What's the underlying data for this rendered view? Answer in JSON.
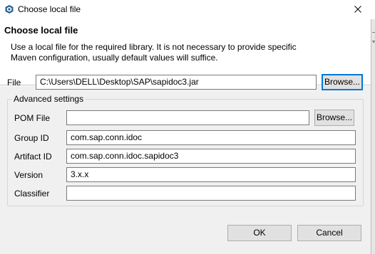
{
  "window": {
    "title": "Choose local file",
    "close_icon": "close-icon",
    "app_icon": "app-logo-icon"
  },
  "header": {
    "title": "Choose local file",
    "description": "Use a local file for the required library. It is not necessary to provide specific Maven configuration, usually default values will suffice."
  },
  "file": {
    "label": "File",
    "value": "C:\\Users\\DELL\\Desktop\\SAP\\sapidoc3.jar",
    "browse_label": "Browse..."
  },
  "advanced": {
    "legend": "Advanced settings",
    "pom_label": "POM File",
    "pom_value": "",
    "pom_browse_label": "Browse...",
    "group_id_label": "Group ID",
    "group_id_value": "com.sap.conn.idoc",
    "artifact_id_label": "Artifact ID",
    "artifact_id_value": "com.sap.conn.idoc.sapidoc3",
    "version_label": "Version",
    "version_value": "3.x.x",
    "classifier_label": "Classifier",
    "classifier_value": ""
  },
  "footer": {
    "ok_label": "OK",
    "cancel_label": "Cancel"
  },
  "colors": {
    "accent": "#0078d7",
    "dialog_bg": "#f0f0f0",
    "header_bg": "#ffffff"
  }
}
